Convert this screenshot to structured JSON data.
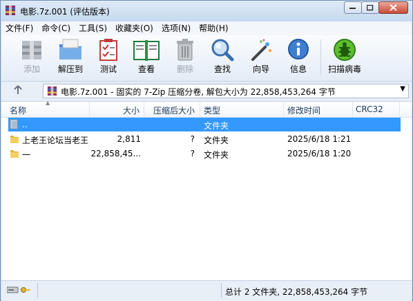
{
  "window": {
    "title": "电影.7z.001 (评估版本)"
  },
  "menu": [
    "文件(F)",
    "命令(C)",
    "工具(S)",
    "收藏夹(O)",
    "选项(N)",
    "帮助(H)"
  ],
  "toolbar": {
    "add": "添加",
    "extract": "解压到",
    "test": "测试",
    "view": "查看",
    "delete": "删除",
    "find": "查找",
    "wizard": "向导",
    "info": "信息",
    "virus": "扫描病毒"
  },
  "address": {
    "path": "电影.7z.001 - 固实的 7-Zip 压缩分卷, 解包大小为 22,858,453,264 字节"
  },
  "columns": {
    "name": "名称",
    "size": "大小",
    "packed": "压缩后大小",
    "type": "类型",
    "modified": "修改时间",
    "crc": "CRC32"
  },
  "rows": [
    {
      "name": "..",
      "size": "",
      "packed": "",
      "type": "文件夹",
      "modified": ""
    },
    {
      "name": "上老王论坛当老王",
      "size": "2,811",
      "packed": "?",
      "type": "文件夹",
      "modified": "2025/6/18 1:21"
    },
    {
      "name": "一",
      "size": "22,858,45...",
      "packed": "?",
      "type": "文件夹",
      "modified": "2025/6/18 1:20"
    }
  ],
  "status": {
    "summary": "总计 2 文件夹, 22,858,453,264 字节"
  }
}
